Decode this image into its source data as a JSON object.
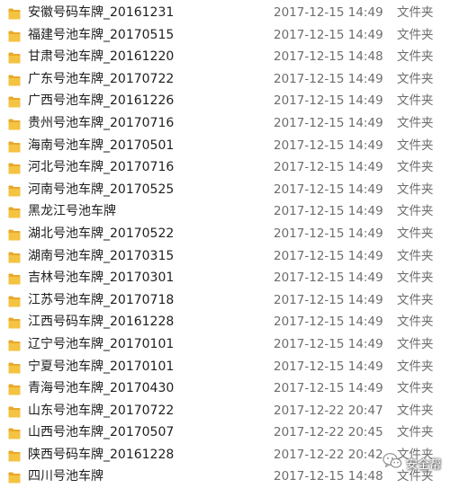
{
  "icons": {
    "row_icon": "folder-icon",
    "watermark_icon": "wechat-icon"
  },
  "colors": {
    "folder_body": "#f5c342",
    "folder_tab": "#e8a82a",
    "row_hover": "#e5f3ff"
  },
  "files": [
    {
      "name": "安徽号码车牌_20161231",
      "modified": "2017-12-15 14:49",
      "type": "文件夹"
    },
    {
      "name": "福建号池车牌_20170515",
      "modified": "2017-12-15 14:49",
      "type": "文件夹"
    },
    {
      "name": "甘肃号池车牌_20161220",
      "modified": "2017-12-15 14:48",
      "type": "文件夹"
    },
    {
      "name": "广东号池车牌_20170722",
      "modified": "2017-12-15 14:49",
      "type": "文件夹"
    },
    {
      "name": "广西号池车牌_20161226",
      "modified": "2017-12-15 14:49",
      "type": "文件夹"
    },
    {
      "name": "贵州号池车牌_20170716",
      "modified": "2017-12-15 14:49",
      "type": "文件夹"
    },
    {
      "name": "海南号池车牌_20170501",
      "modified": "2017-12-15 14:49",
      "type": "文件夹"
    },
    {
      "name": "河北号池车牌_20170716",
      "modified": "2017-12-15 14:49",
      "type": "文件夹"
    },
    {
      "name": "河南号池车牌_20170525",
      "modified": "2017-12-15 14:49",
      "type": "文件夹"
    },
    {
      "name": "黑龙江号池车牌",
      "modified": "2017-12-15 14:49",
      "type": "文件夹"
    },
    {
      "name": "湖北号池车牌_20170522",
      "modified": "2017-12-15 14:49",
      "type": "文件夹"
    },
    {
      "name": "湖南号池车牌_20170315",
      "modified": "2017-12-15 14:49",
      "type": "文件夹"
    },
    {
      "name": "吉林号池车牌_20170301",
      "modified": "2017-12-15 14:49",
      "type": "文件夹"
    },
    {
      "name": "江苏号池车牌_20170718",
      "modified": "2017-12-15 14:49",
      "type": "文件夹"
    },
    {
      "name": "江西号码车牌_20161228",
      "modified": "2017-12-15 14:49",
      "type": "文件夹"
    },
    {
      "name": "辽宁号池车牌_20170101",
      "modified": "2017-12-15 14:49",
      "type": "文件夹"
    },
    {
      "name": "宁夏号池车牌_20170101",
      "modified": "2017-12-15 14:49",
      "type": "文件夹"
    },
    {
      "name": "青海号池车牌_20170430",
      "modified": "2017-12-15 14:49",
      "type": "文件夹"
    },
    {
      "name": "山东号池车牌_20170722",
      "modified": "2017-12-22 20:47",
      "type": "文件夹"
    },
    {
      "name": "山西号池车牌_20170507",
      "modified": "2017-12-22 20:45",
      "type": "文件夹"
    },
    {
      "name": "陕西号码车牌_20161228",
      "modified": "2017-12-22 20:42",
      "type": "文件夹"
    },
    {
      "name": "四川号池车牌",
      "modified": "2017-12-15 14:48",
      "type": "文件夹"
    }
  ],
  "watermark": {
    "text": "安全帮"
  }
}
